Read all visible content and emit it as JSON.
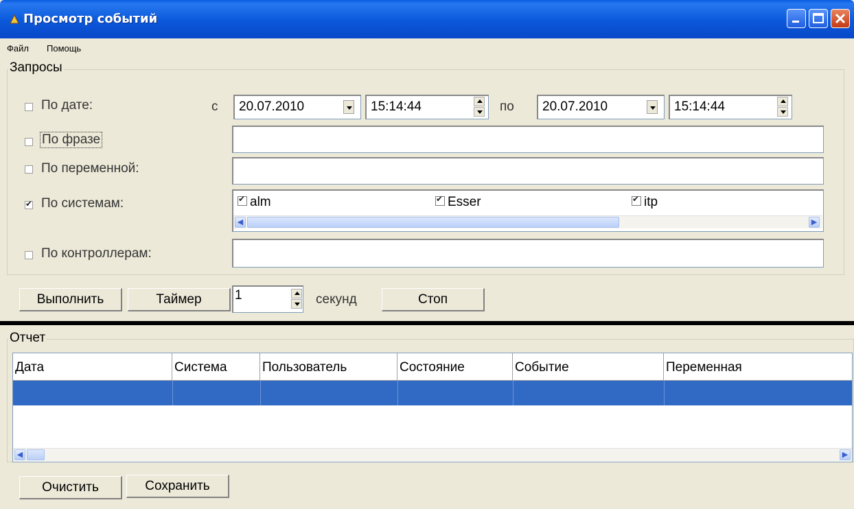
{
  "window": {
    "title": "Просмотр событий"
  },
  "menu": [
    "Файл",
    "Помощь"
  ],
  "queries": {
    "legend": "Запросы",
    "by_date": {
      "label": "По дате:",
      "checked": false,
      "from_label": "с",
      "from_date": "20.07.2010",
      "from_time": "15:14:44",
      "to_label": "по",
      "to_date": "20.07.2010",
      "to_time": "15:14:44"
    },
    "by_phrase": {
      "label": "По фразе",
      "checked": false,
      "value": ""
    },
    "by_variable": {
      "label": "По переменной:",
      "checked": false,
      "value": ""
    },
    "by_systems": {
      "label": "По системам:",
      "checked": true,
      "items": [
        {
          "label": "alm",
          "checked": true
        },
        {
          "label": "Esser",
          "checked": true
        },
        {
          "label": "itp",
          "checked": true
        }
      ]
    },
    "by_controllers": {
      "label": "По контроллерам:",
      "checked": false,
      "value": ""
    }
  },
  "toolbar": {
    "run": "Выполнить",
    "timer": "Таймер",
    "interval": "1",
    "seconds": "секунд",
    "stop": "Стоп"
  },
  "report": {
    "legend": "Отчет",
    "columns": [
      "Дата",
      "Система",
      "Пользователь",
      "Состояние",
      "Событие",
      "Переменная"
    ]
  },
  "bottom": {
    "clear": "Очистить",
    "save": "Сохранить"
  },
  "colors": {
    "titlebar": "#0a58da",
    "selection": "#316ac5",
    "face": "#ece9d8"
  }
}
